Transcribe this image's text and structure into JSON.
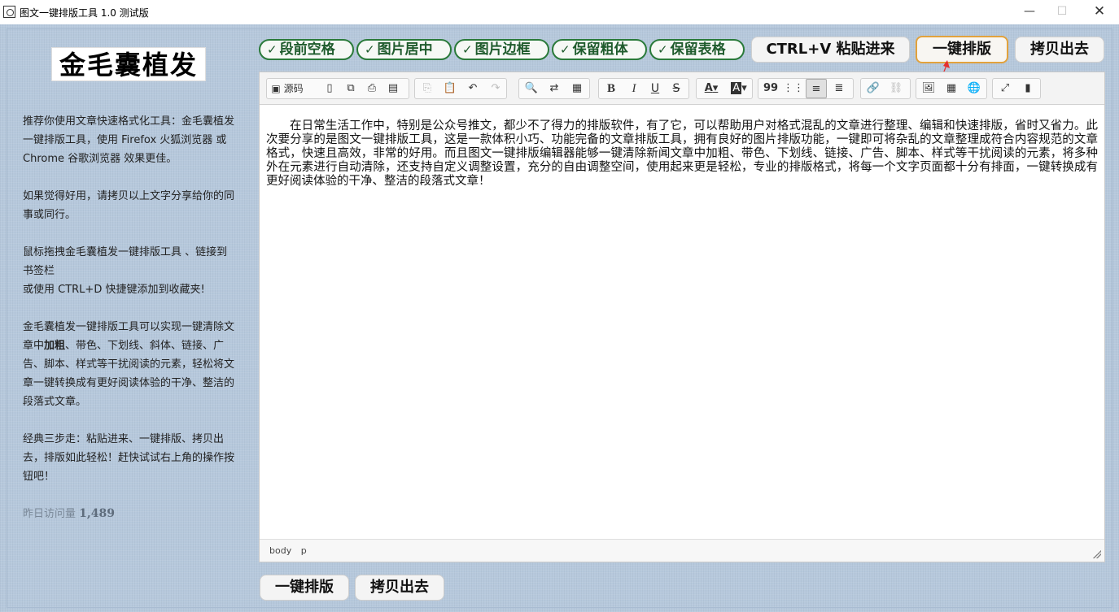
{
  "window": {
    "title": "图文一键排版工具 1.0 测试版",
    "min": "—",
    "max": "☐",
    "close": "✕"
  },
  "sidebar": {
    "logo": "金毛囊植发",
    "p1": "推荐你使用文章快速格式化工具：金毛囊植发一键排版工具，使用 Firefox 火狐浏览器 或 Chrome 谷歌浏览器 效果更佳。",
    "p2": "如果觉得好用，请拷贝以上文字分享给你的同事或同行。",
    "p3a": "鼠标拖拽金毛囊植发一键排版工具 、链接到书签栏",
    "p3b": "或使用 CTRL+D 快捷键添加到收藏夹!",
    "p4_pre": "金毛囊植发一键排版工具可以实现一键清除文章中",
    "p4_bold": "加粗",
    "p4_post": "、带色、下划线、斜体、链接、广告、脚本、样式等干扰阅读的元素，轻松将文章一键转换成有更好阅读体验的干净、整洁的段落式文章。",
    "p5": "经典三步走：粘贴进来、一键排版、拷贝出去，排版如此轻松！赶快试试右上角的操作按钮吧！",
    "visits_label": "昨日访问量",
    "visits_value": "1,489"
  },
  "options": [
    {
      "check": "✓",
      "label": "段前空格"
    },
    {
      "check": "✓",
      "label": "图片居中"
    },
    {
      "check": "✓",
      "label": "图片边框"
    },
    {
      "check": "✓",
      "label": "保留粗体"
    },
    {
      "check": "✓",
      "label": "保留表格"
    }
  ],
  "actions": {
    "paste": "CTRL+V 粘贴进来",
    "format": "一键排版",
    "copy": "拷贝出去",
    "format_bottom": "一键排版",
    "copy_bottom": "拷贝出去"
  },
  "toolbar": {
    "source": "源码",
    "bold": "B",
    "italic": "I",
    "underline": "U",
    "strike": "S",
    "font_color": "A",
    "bg_color": "A",
    "quote": "99"
  },
  "editor": {
    "content": "在日常生活工作中，特别是公众号推文，都少不了得力的排版软件，有了它，可以帮助用户对格式混乱的文章进行整理、编辑和快速排版，省时又省力。此次要分享的是图文一键排版工具，这是一款体积小巧、功能完备的文章排版工具，拥有良好的图片排版功能，一键即可将杂乱的文章整理成符合内容规范的文章格式，快速且高效，非常的好用。而且图文一键排版编辑器能够一键清除新闻文章中加粗、带色、下划线、链接、广告、脚本、样式等干扰阅读的元素，将多种外在元素进行自动清除，还支持自定义调整设置，充分的自由调整空间，使用起来更是轻松，专业的排版格式，将每一个文字页面都十分有排面，一键转换成有更好阅读体验的干净、整洁的段落式文章！",
    "path": [
      "body",
      "p"
    ]
  },
  "colors": {
    "background": "#b6c8dc",
    "option_green": "#2a7a3a",
    "highlight_orange": "#e2a23c",
    "arrow_red": "#e53030"
  }
}
